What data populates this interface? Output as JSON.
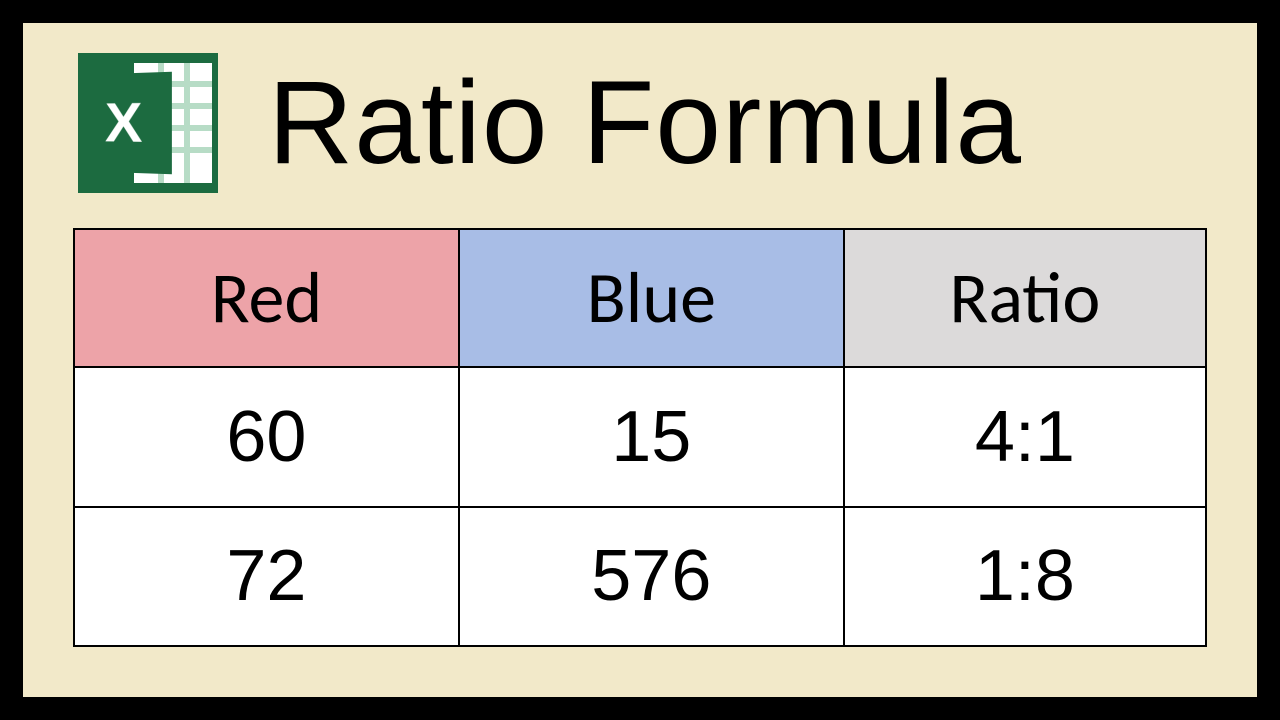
{
  "title": "Ratio Formula",
  "icon_letter": "X",
  "table": {
    "headers": [
      "Red",
      "Blue",
      "Ratio"
    ],
    "rows": [
      {
        "red": "60",
        "blue": "15",
        "ratio": "4:1"
      },
      {
        "red": "72",
        "blue": "576",
        "ratio": "1:8"
      }
    ]
  },
  "chart_data": {
    "type": "table",
    "title": "Ratio Formula",
    "columns": [
      "Red",
      "Blue",
      "Ratio"
    ],
    "rows": [
      [
        60,
        15,
        "4:1"
      ],
      [
        72,
        576,
        "1:8"
      ]
    ]
  }
}
